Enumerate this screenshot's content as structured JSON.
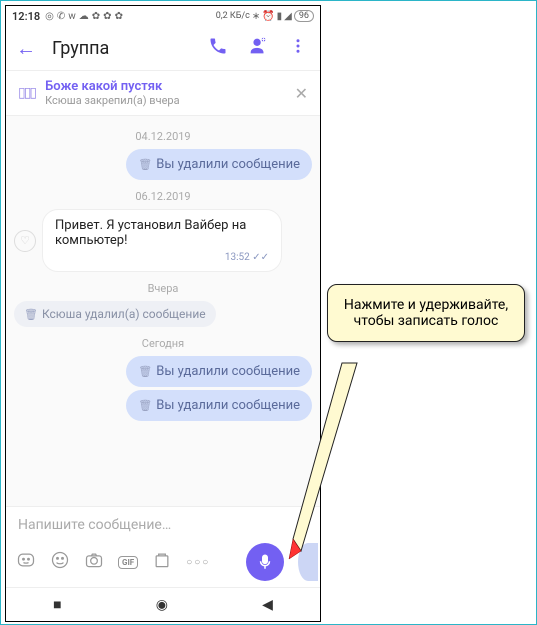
{
  "status": {
    "time": "12:18",
    "data_rate": "0,2 КБ/с",
    "battery": "96"
  },
  "header": {
    "title": "Группа"
  },
  "pinned": {
    "title": "Боже какой пустяк",
    "subtitle": "Ксюша закрепил(а) вчера"
  },
  "dates": {
    "d1": "04.12.2019",
    "d2": "06.12.2019",
    "d3": "Вчера",
    "d4": "Сегодня"
  },
  "msgs": {
    "deleted": "Вы удалили сообщение",
    "incoming": "Привет. Я установил Вайбер на компьютер!",
    "incoming_time": "13:52 ✓✓",
    "other_deleted": "Ксюша удалил(а) сообщение"
  },
  "input": {
    "placeholder": "Напишите сообщение…",
    "gif": "GIF",
    "more": "○○○"
  },
  "tooltip": {
    "text": "Нажмите и удерживайте, чтобы записать голос"
  }
}
